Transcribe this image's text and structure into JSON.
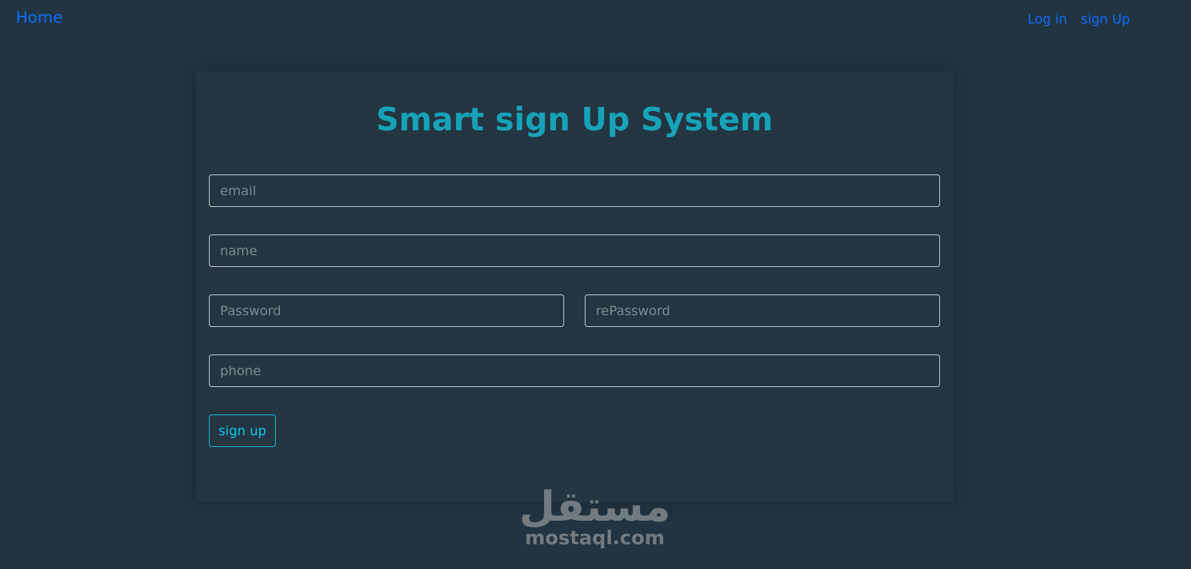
{
  "navbar": {
    "home_label": "Home",
    "login_label": "Log in",
    "signup_label": "sign Up"
  },
  "form": {
    "title": "Smart sign Up System",
    "email_placeholder": "email",
    "name_placeholder": "name",
    "password_placeholder": "Password",
    "repassword_placeholder": "rePassword",
    "phone_placeholder": "phone",
    "submit_label": "sign up"
  },
  "watermark": {
    "arabic": "مستقل",
    "latin": "mostaql.com"
  },
  "colors": {
    "background": "#223441",
    "link": "#0d6efd",
    "title": "#17a2b8",
    "button": "#0dcaf0"
  }
}
